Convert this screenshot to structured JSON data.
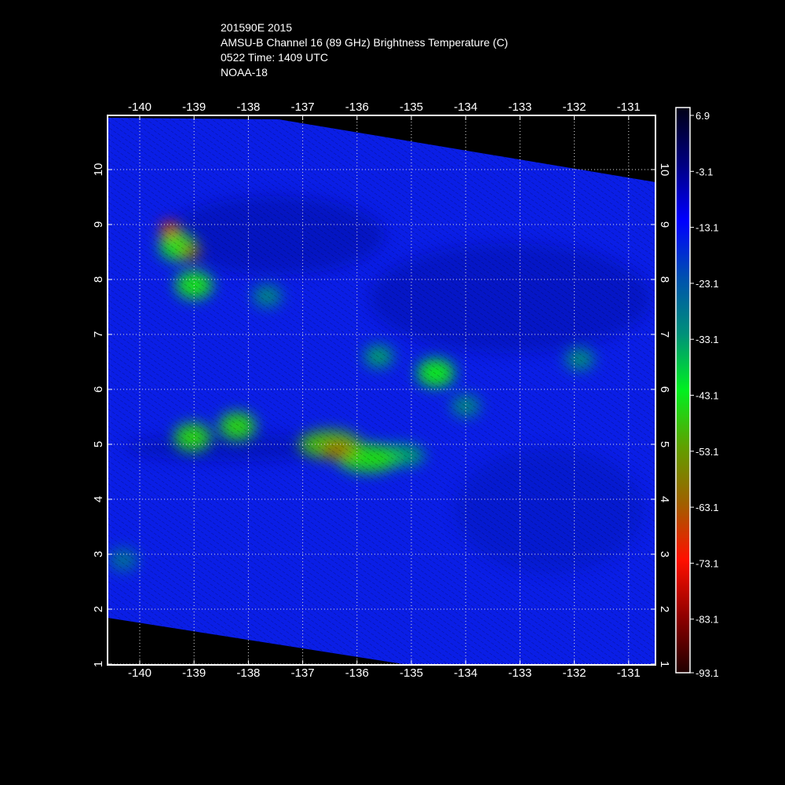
{
  "header": {
    "storm_id": "201590E 2015",
    "product": "AMSU-B Channel 16 (89 GHz) Brightness Temperature (C)",
    "time": "0522 Time: 1409 UTC",
    "satellite": "NOAA-18"
  },
  "axes": {
    "lon_ticks": [
      "-140",
      "-139",
      "-138",
      "-137",
      "-136",
      "-135",
      "-134",
      "-133",
      "-132",
      "-131"
    ],
    "lon_values": [
      -140,
      -139,
      -138,
      -137,
      -136,
      -135,
      -134,
      -133,
      -132,
      -131
    ],
    "lat_ticks": [
      "1",
      "2",
      "3",
      "4",
      "5",
      "6",
      "7",
      "8",
      "9",
      "10"
    ],
    "lat_values": [
      1,
      2,
      3,
      4,
      5,
      6,
      7,
      8,
      9,
      10
    ],
    "lon_range": [
      -140.6,
      -130.5
    ],
    "lat_range": [
      1.0,
      11.0
    ]
  },
  "colorbar": {
    "labels": [
      "6.9",
      "-3.1",
      "-13.1",
      "-23.1",
      "-33.1",
      "-43.1",
      "-53.1",
      "-63.1",
      "-73.1",
      "-83.1",
      "-93.1"
    ],
    "range": [
      6.9,
      -93.1
    ],
    "colors": [
      "#000015",
      "#000080",
      "#0000ff",
      "#0050b0",
      "#00907a",
      "#00f020",
      "#60a000",
      "#a06000",
      "#ff1000",
      "#900000",
      "#200000"
    ]
  },
  "features": [
    {
      "name": "cluster-nw-core",
      "lon": -139.45,
      "lat": 8.93,
      "temp": -70
    },
    {
      "name": "cluster-nw-south",
      "lon": -139.05,
      "lat": 8.5,
      "temp": -62
    },
    {
      "name": "cluster-nw-west",
      "lon": -139.3,
      "lat": 8.6,
      "temp": -45
    },
    {
      "name": "cluster-nw-lower",
      "lon": -139.0,
      "lat": 7.9,
      "temp": -45
    },
    {
      "name": "cell-137-7",
      "lon": -137.65,
      "lat": 7.7,
      "temp": -32
    },
    {
      "name": "cell-139-5",
      "lon": -139.03,
      "lat": 5.13,
      "temp": -47
    },
    {
      "name": "cell-138-5",
      "lon": -138.2,
      "lat": 5.33,
      "temp": -47
    },
    {
      "name": "main-band-west",
      "lon": -136.5,
      "lat": 5.0,
      "temp": -50
    },
    {
      "name": "main-band-core",
      "lon": -136.35,
      "lat": 4.9,
      "temp": -64
    },
    {
      "name": "main-band-east",
      "lon": -135.8,
      "lat": 4.75,
      "temp": -46
    },
    {
      "name": "main-band-tail",
      "lon": -135.2,
      "lat": 4.8,
      "temp": -35
    },
    {
      "name": "cell-135-6.7",
      "lon": -135.6,
      "lat": 6.6,
      "temp": -35
    },
    {
      "name": "cell-134-6",
      "lon": -134.55,
      "lat": 6.3,
      "temp": -44
    },
    {
      "name": "cell-134-5.6",
      "lon": -134.0,
      "lat": 5.7,
      "temp": -32
    },
    {
      "name": "cell-132-6.5",
      "lon": -131.9,
      "lat": 6.55,
      "temp": -33
    },
    {
      "name": "cell-140-3",
      "lon": -140.3,
      "lat": 2.9,
      "temp": -28
    }
  ]
}
